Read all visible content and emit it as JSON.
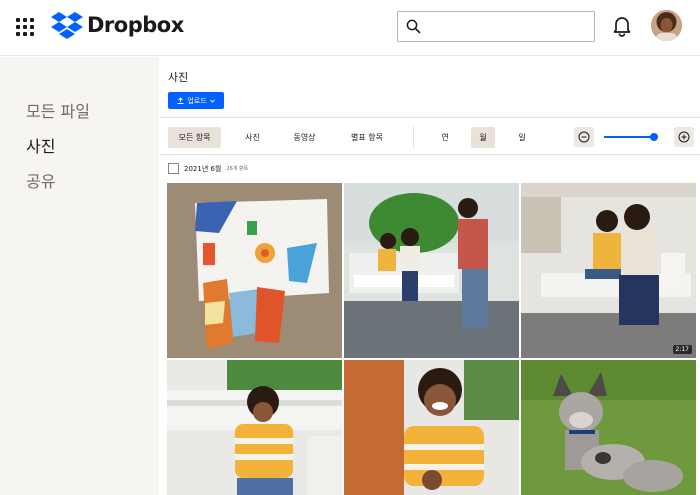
{
  "header": {
    "logo_text": "Dropbox",
    "search": {
      "placeholder": ""
    },
    "icons": [
      "apps-grid-icon",
      "dropbox-logo-icon",
      "search-icon",
      "bell-icon"
    ]
  },
  "sidebar": {
    "items": [
      {
        "label": "모든 파일",
        "active": false
      },
      {
        "label": "사진",
        "active": true
      },
      {
        "label": "공유",
        "active": false
      }
    ]
  },
  "main": {
    "title": "사진",
    "upload_label": "업로드",
    "filters": [
      {
        "label": "모든 항목",
        "active": true
      },
      {
        "label": "사진",
        "active": false
      },
      {
        "label": "동영상",
        "active": false
      },
      {
        "label": "별표 항목",
        "active": false
      }
    ],
    "periods": [
      {
        "label": "연",
        "active": false
      },
      {
        "label": "월",
        "active": true
      },
      {
        "label": "일",
        "active": false
      }
    ],
    "zoom_level": 0.85,
    "section": {
      "date": "2021년 6월",
      "count": "26개 항목"
    },
    "photos": [
      {
        "name": "paper-collage",
        "badge": ""
      },
      {
        "name": "family-photo-porch",
        "badge": ""
      },
      {
        "name": "porch-swing-mother-son",
        "badge": "2:17"
      },
      {
        "name": "child-on-swing",
        "badge": ""
      },
      {
        "name": "child-laughing",
        "badge": ""
      },
      {
        "name": "two-dogs",
        "badge": ""
      }
    ]
  },
  "colors": {
    "accent": "#0061fe",
    "sidebar_bg": "#f7f5f2",
    "active_filter_bg": "#e8e2d9"
  }
}
